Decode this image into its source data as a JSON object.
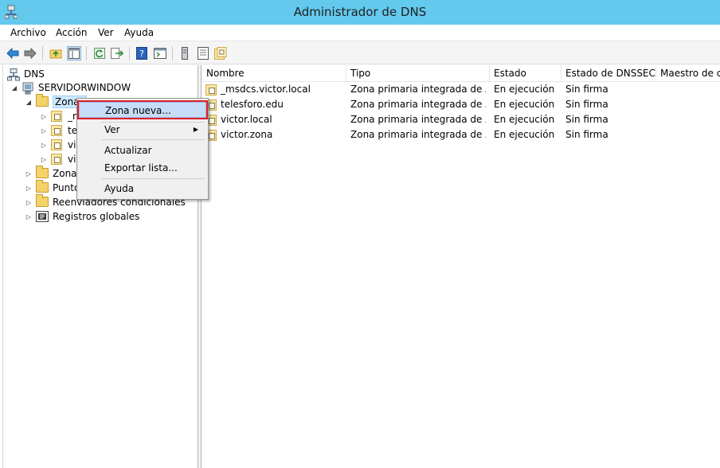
{
  "window": {
    "title": "Administrador de DNS"
  },
  "menu": [
    "Archivo",
    "Acción",
    "Ver",
    "Ayuda"
  ],
  "toolbar": {
    "buttons": [
      "back-icon",
      "forward-icon",
      "up-folder-icon",
      "show-tree-icon",
      "refresh-icon",
      "export-icon",
      "help-icon",
      "console-icon",
      "server-icon",
      "list-icon",
      "zone-icon"
    ]
  },
  "tree": {
    "root": "DNS",
    "server": "SERVIDORWINDOW",
    "zones_partial": "Zonas",
    "zone_children": [
      "_m",
      "te",
      "vi",
      "vi"
    ],
    "zones_reverse_partial": "Zonas",
    "points_partial": "Punto",
    "conditional": "Reenviadores condicionales",
    "global": "Registros globales"
  },
  "list": {
    "columns": [
      "Nombre",
      "Tipo",
      "Estado",
      "Estado de DNSSEC",
      "Maestro de c..."
    ],
    "rows": [
      {
        "name": "_msdcs.victor.local",
        "type": "Zona primaria integrada de A...",
        "state": "En ejecución",
        "dnssec": "Sin firma"
      },
      {
        "name": "telesforo.edu",
        "type": "Zona primaria integrada de A...",
        "state": "En ejecución",
        "dnssec": "Sin firma"
      },
      {
        "name": "victor.local",
        "type": "Zona primaria integrada de A...",
        "state": "En ejecución",
        "dnssec": "Sin firma"
      },
      {
        "name": "victor.zona",
        "type": "Zona primaria integrada de A...",
        "state": "En ejecución",
        "dnssec": "Sin firma"
      }
    ]
  },
  "context_menu": {
    "new_zone": "Zona nueva...",
    "view": "Ver",
    "refresh": "Actualizar",
    "export": "Exportar lista...",
    "help": "Ayuda"
  }
}
